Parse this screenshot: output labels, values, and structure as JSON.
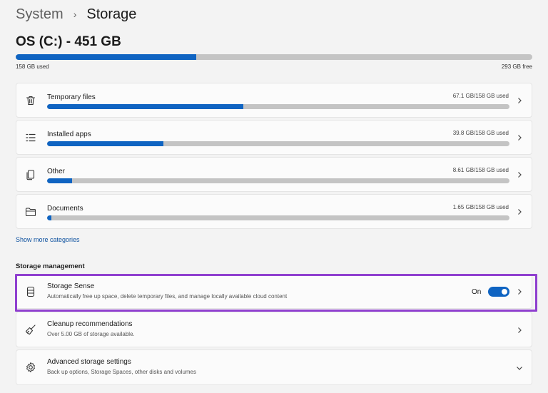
{
  "breadcrumb": {
    "parent": "System",
    "separator": "›",
    "current": "Storage"
  },
  "drive": {
    "title": "OS (C:) - 451 GB",
    "used_label": "158 GB used",
    "free_label": "293 GB free",
    "used_fraction": 0.35
  },
  "categories": [
    {
      "name": "Temporary files",
      "usage": "67.1 GB/158 GB used",
      "fraction": 0.425,
      "icon": "trash-icon"
    },
    {
      "name": "Installed apps",
      "usage": "39.8 GB/158 GB used",
      "fraction": 0.252,
      "icon": "list-icon"
    },
    {
      "name": "Other",
      "usage": "8.61 GB/158 GB used",
      "fraction": 0.054,
      "icon": "copy-icon"
    },
    {
      "name": "Documents",
      "usage": "1.65 GB/158 GB used",
      "fraction": 0.01,
      "icon": "folder-icon"
    }
  ],
  "show_more": "Show more categories",
  "management": {
    "heading": "Storage management",
    "items": [
      {
        "title": "Storage Sense",
        "desc": "Automatically free up space, delete temporary files, and manage locally available cloud content",
        "icon": "database-icon",
        "toggle_label": "On",
        "toggle_on": true
      },
      {
        "title": "Cleanup recommendations",
        "desc": "Over 5.00 GB of storage available.",
        "icon": "broom-icon"
      },
      {
        "title": "Advanced storage settings",
        "desc": "Back up options, Storage Spaces, other disks and volumes",
        "icon": "gear-icon"
      }
    ]
  },
  "colors": {
    "accent": "#0f64c2",
    "highlight": "#8f3fcf",
    "track": "#c4c4c4"
  }
}
